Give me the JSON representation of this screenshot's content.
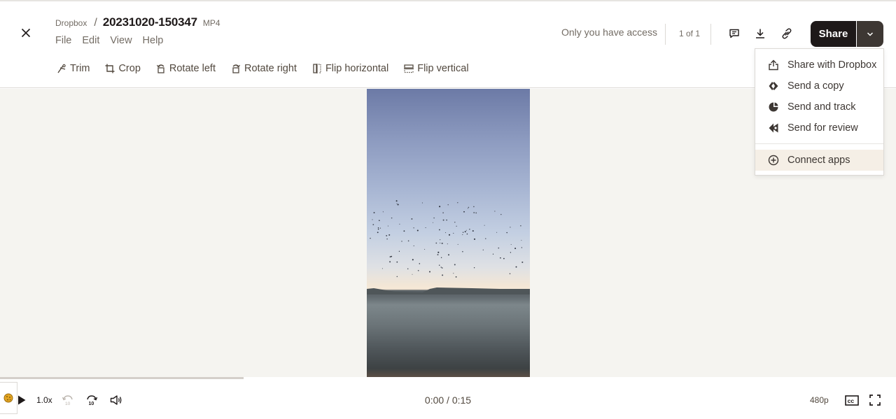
{
  "breadcrumb": {
    "root": "Dropbox",
    "separator": "/",
    "file_name": "20231020-150347",
    "file_ext": "MP4"
  },
  "menu": [
    "File",
    "Edit",
    "View",
    "Help"
  ],
  "tools": [
    {
      "label": "Trim",
      "icon": "scissors-icon"
    },
    {
      "label": "Crop",
      "icon": "crop-icon"
    },
    {
      "label": "Rotate left",
      "icon": "rotate-left-icon"
    },
    {
      "label": "Rotate right",
      "icon": "rotate-right-icon"
    },
    {
      "label": "Flip horizontal",
      "icon": "flip-horizontal-icon"
    },
    {
      "label": "Flip vertical",
      "icon": "flip-vertical-icon"
    }
  ],
  "header": {
    "access_text": "Only you have access",
    "file_count": "1 of 1",
    "share_label": "Share"
  },
  "share_menu": {
    "items": [
      {
        "label": "Share with Dropbox",
        "icon": "share-upload-icon"
      },
      {
        "label": "Send a copy",
        "icon": "send-copy-icon"
      },
      {
        "label": "Send and track",
        "icon": "send-track-icon"
      },
      {
        "label": "Send for review",
        "icon": "send-review-icon"
      }
    ],
    "footer_item": {
      "label": "Connect apps",
      "icon": "plus-circle-icon"
    }
  },
  "player": {
    "speed": "1.0x",
    "time_display": "0:00 / 0:15",
    "quality": "480p",
    "buffered_fraction": 0.272,
    "played_fraction": 0,
    "accent_color": "#1e1919",
    "buffer_color": "#d4cfca"
  }
}
